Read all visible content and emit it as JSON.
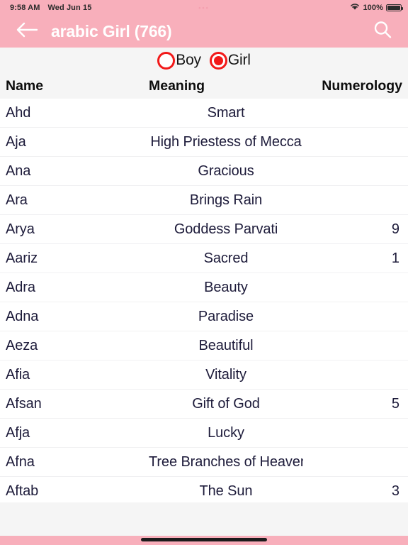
{
  "status_bar": {
    "time": "9:58 AM",
    "date": "Wed Jun 15",
    "battery_percent": "100%",
    "wifi_icon": "wifi-icon",
    "battery_icon": "battery-full-icon"
  },
  "nav": {
    "back_icon": "arrow-left-icon",
    "title": "arabic Girl (766)",
    "search_icon": "search-icon",
    "background_color": "#f8afbb",
    "title_color": "#ffffff"
  },
  "gender_selector": {
    "accent_color": "#f21919",
    "options": [
      {
        "label": "Boy",
        "selected": false
      },
      {
        "label": "Girl",
        "selected": true
      }
    ]
  },
  "table": {
    "columns": [
      "Name",
      "Meaning",
      "Numerology"
    ],
    "rows": [
      {
        "name": "Ahd",
        "meaning": "Smart",
        "numerology": ""
      },
      {
        "name": "Aja",
        "meaning": "High Priestess of Mecca",
        "numerology": ""
      },
      {
        "name": "Ana",
        "meaning": "Gracious",
        "numerology": ""
      },
      {
        "name": "Ara",
        "meaning": "Brings Rain",
        "numerology": ""
      },
      {
        "name": "Arya",
        "meaning": "Goddess Parvati",
        "numerology": "9"
      },
      {
        "name": "Aariz",
        "meaning": "Sacred",
        "numerology": "1"
      },
      {
        "name": "Adra",
        "meaning": "Beauty",
        "numerology": ""
      },
      {
        "name": "Adna",
        "meaning": "Paradise",
        "numerology": ""
      },
      {
        "name": "Aeza",
        "meaning": "Beautiful",
        "numerology": ""
      },
      {
        "name": "Afia",
        "meaning": "Vitality",
        "numerology": ""
      },
      {
        "name": "Afsan",
        "meaning": "Gift of God",
        "numerology": "5"
      },
      {
        "name": "Afja",
        "meaning": "Lucky",
        "numerology": ""
      },
      {
        "name": "Afna",
        "meaning": "Tree Branches of Heaven",
        "numerology": ""
      },
      {
        "name": "Aftab",
        "meaning": "The Sun",
        "numerology": "3"
      }
    ]
  },
  "home_indicator": {
    "icon": "home-indicator"
  }
}
